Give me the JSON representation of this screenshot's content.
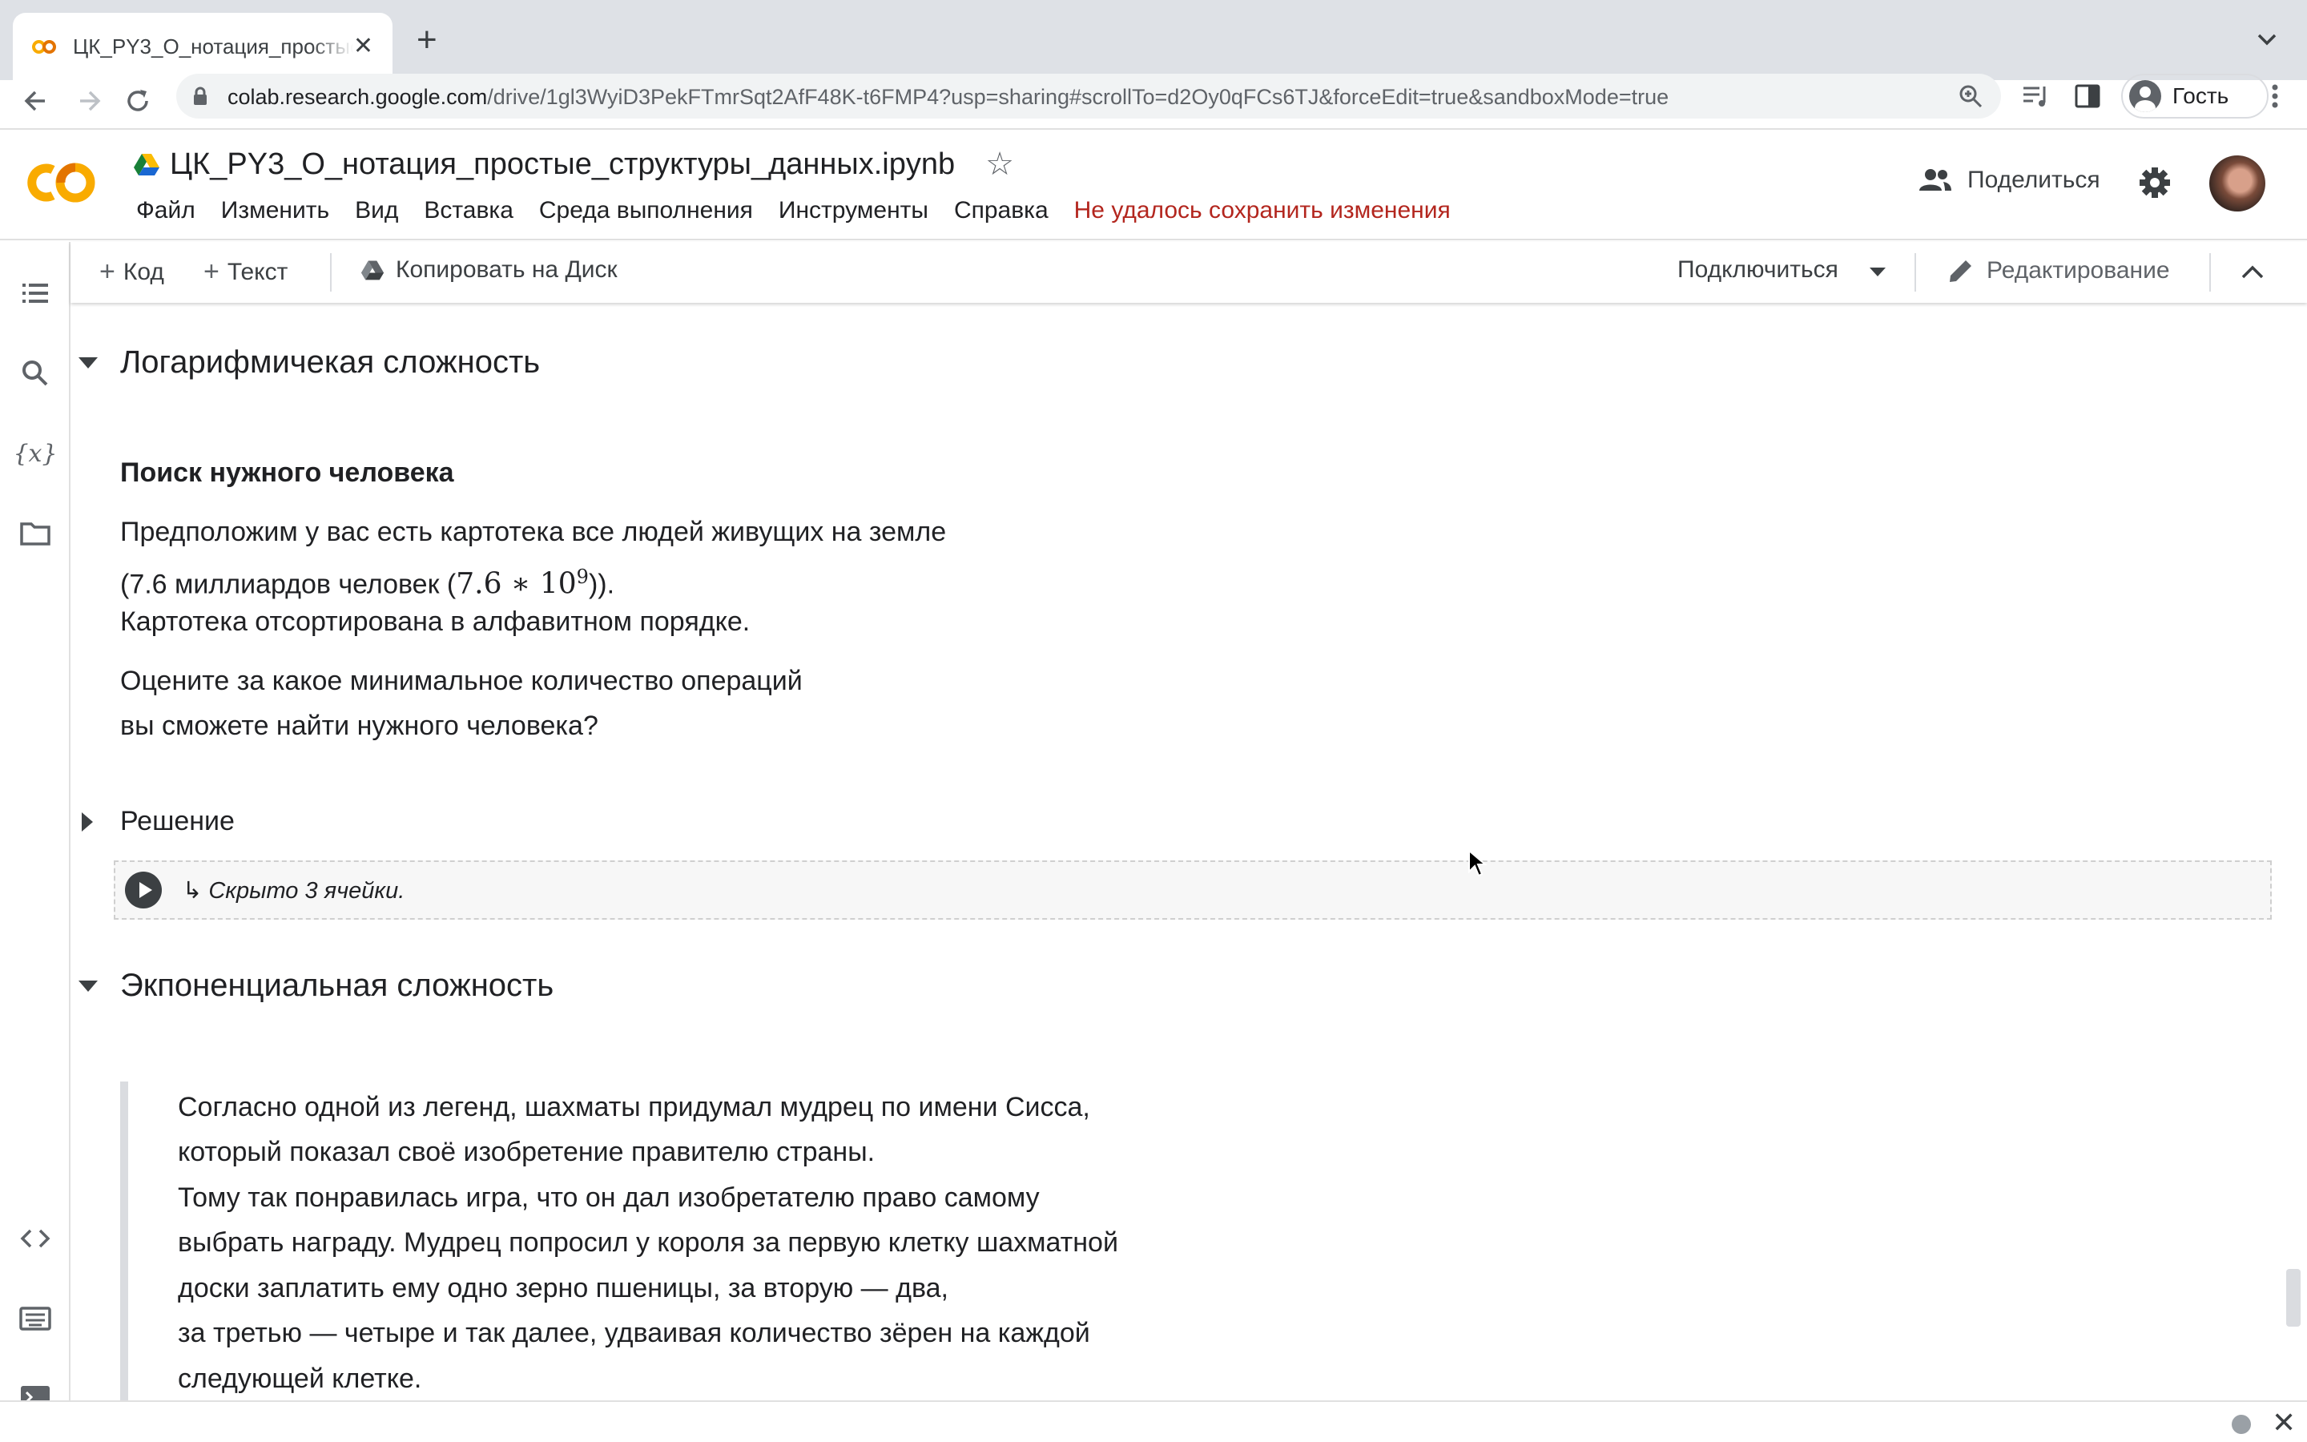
{
  "browser": {
    "tab_title": "ЦК_PY3_O_нотация_простые_структуры_данных.ipynb",
    "tab_close": "✕",
    "new_tab": "+",
    "url_host": "colab.research.google.com",
    "url_path": "/drive/1gl3WyiD3PekFTmrSqt2AfF48K-t6FMP4?usp=sharing#scrollTo=d2Oy0qFCs6TJ&forceEdit=true&sandboxMode=true",
    "profile_label": "Гость"
  },
  "header": {
    "notebook_title": "ЦК_PY3_O_нотация_простые_структуры_данных.ipynb",
    "menu": [
      "Файл",
      "Изменить",
      "Вид",
      "Вставка",
      "Среда выполнения",
      "Инструменты",
      "Справка"
    ],
    "save_warning": "Не удалось сохранить изменения",
    "share_label": "Поделиться"
  },
  "notebook_toolbar": {
    "add_code": "Код",
    "add_text": "Текст",
    "copy_to_drive": "Копировать на Диск",
    "connect": "Подключиться",
    "editing": "Редактирование"
  },
  "content": {
    "section1_title": "Логарифмичекая сложность",
    "subheading": "Поиск нужного человека",
    "p1_line1": "Предположим у вас есть картотека все людей живущих на земле",
    "p1_line2_a": "(7.6 миллиардов человек (",
    "p1_line2_math": "7.6 ∗ 10",
    "p1_line2_exp": "9",
    "p1_line2_b": ")).",
    "p1_line3": "Картотека отсортирована в алфавитном порядке.",
    "p2_line1": "Оцените за какое минимальное количество операций",
    "p2_line2": "вы сможете найти нужного человека?",
    "solution_title": "Решение",
    "hidden_cells": "↳ Скрыто 3 ячейки.",
    "section2_title": "Экпоненциальная сложность",
    "quote_lines": [
      "Согласно одной из легенд, шахматы придумал мудрец по имени Сисса,",
      "который показал своё изобретение правителю страны.",
      "Тому так понравилась игра, что он дал изобретателю право самому",
      "выбрать награду. Мудрец попросил у короля за первую клетку шахматной",
      "доски заплатить ему одно зерно пшеницы, за вторую — два,",
      "за третью — четыре и так далее, удваивая количество зёрен на каждой",
      "следующей клетке."
    ]
  },
  "footer": {
    "close": "✕"
  },
  "colors": {
    "accent_warning": "#b3261e",
    "colab_orange": "#f9ab00",
    "colab_dark_orange": "#e37400"
  }
}
